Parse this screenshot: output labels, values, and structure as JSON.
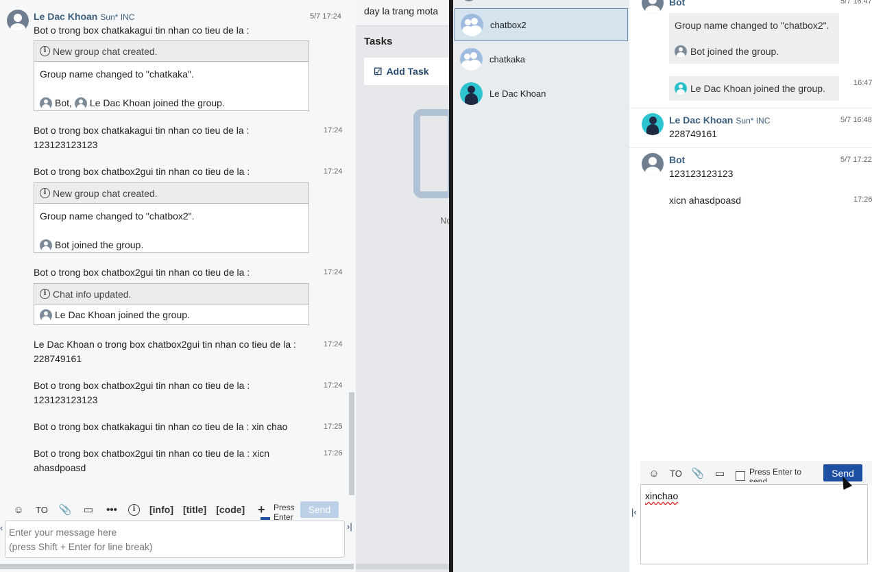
{
  "left": {
    "first_msg": {
      "sender": "Le Dac Khoan",
      "org": "Sun* INC",
      "time": "5/7 17:24",
      "text": "Bot o trong box chatkakagui tin nhan co tieu de la :",
      "box_header": "New group chat created.",
      "box_line1": "Group name changed to \"chatkaka\".",
      "box_line2_a": "Bot,",
      "box_line2_b": "Le Dac Khoan joined the group."
    },
    "msg2": {
      "time": "17:24",
      "line1": "Bot o trong box chatkakagui tin nhan co tieu de la :",
      "line2": "123123123123"
    },
    "msg3": {
      "time": "17:24",
      "text": "Bot o trong box chatbox2gui tin nhan co tieu de la :",
      "box_header": "New group chat created.",
      "box_line1": "Group name changed to \"chatbox2\".",
      "box_line2": "Bot joined the group."
    },
    "msg4": {
      "time": "17:24",
      "text": "Bot o trong box chatbox2gui tin nhan co tieu de la :",
      "box_header": "Chat info updated.",
      "box_line1": "Le Dac Khoan joined the group."
    },
    "msg5": {
      "time": "17:24",
      "line1": "Le Dac Khoan o trong box chatbox2gui tin nhan co tieu de la :",
      "line2": "228749161"
    },
    "msg6": {
      "time": "17:24",
      "line1": "Bot o trong box chatbox2gui tin nhan co tieu de la :",
      "line2": "123123123123"
    },
    "msg7": {
      "time": "17:25",
      "line1": "Bot o trong box chatkakagui tin nhan co tieu de la : xin chao"
    },
    "msg8": {
      "time": "17:26",
      "line1": "Bot o trong box chatbox2gui tin nhan co tieu de la : xicn",
      "line2": "ahasdpoasd"
    },
    "toolbar": {
      "to": "TO",
      "info": "[info]",
      "title": "[title]",
      "code": "[code]",
      "press_enter": "Press Enter",
      "send": "Send"
    },
    "input_placeholder_1": "Enter your message here",
    "input_placeholder_2": "(press Shift + Enter for line break)"
  },
  "middle": {
    "description": "day la trang mota",
    "tasks_heading": "Tasks",
    "add_task": "Add Task",
    "no_text": "No"
  },
  "right": {
    "rooms": [
      {
        "name": "chatbox2",
        "type": "group",
        "active": true
      },
      {
        "name": "chatkaka",
        "type": "group",
        "active": false
      },
      {
        "name": "Le Dac Khoan",
        "type": "person",
        "active": false
      }
    ],
    "top_sender": "Bot",
    "top_time": "5/7 16:47",
    "sys1_line1": "Group name changed to \"chatbox2\".",
    "sys1_line2": "Bot joined the group.",
    "sys2_text": "Le Dac Khoan joined the group.",
    "sys2_time": "16:47",
    "msg_khoan": {
      "sender": "Le Dac Khoan",
      "org": "Sun* INC",
      "time": "5/7 16:48",
      "text": "228749161"
    },
    "msg_bot": {
      "sender": "Bot",
      "time": "5/7 17:22",
      "text": "123123123123"
    },
    "msg_bot2": {
      "time": "17:26",
      "text": "xicn ahasdpoasd"
    },
    "toolbar": {
      "to": "TO",
      "press_enter_1": "Press Enter to",
      "press_enter_2": "send",
      "send": "Send"
    },
    "input_value": "xinchao"
  },
  "colors": {
    "send_active": "#1d4fa3",
    "send_disabled": "#bcd0e8",
    "sender_name": "#3d5f7e",
    "accent_room": "#d5e3ee"
  }
}
